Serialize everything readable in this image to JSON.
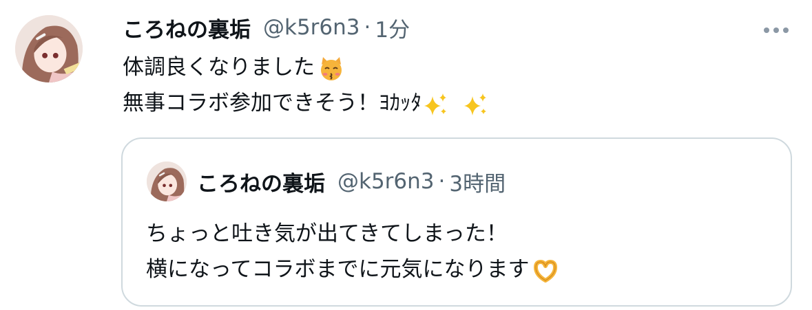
{
  "tweet": {
    "display_name": "ころねの裏垢",
    "handle": "@k5r6n3",
    "time": "1分",
    "line1": "体調良くなりました",
    "line1_emoji": "kissing-cat-emoji",
    "line2": "無事コラボ参加できそう！ﾖｶｯﾀ",
    "line2_emoji": "sparkles-emoji"
  },
  "quoted": {
    "display_name": "ころねの裏垢",
    "handle": "@k5r6n3",
    "time": "3時間",
    "line1": "ちょっと吐き気が出てきてしまった！",
    "line2": "横になってコラボまでに元気になります",
    "line2_emoji": "heart-hands-emoji"
  },
  "colors": {
    "text": "#0f1419",
    "muted": "#536471",
    "border": "#cfd9de"
  },
  "icons": {
    "more": "more-dots-icon"
  }
}
